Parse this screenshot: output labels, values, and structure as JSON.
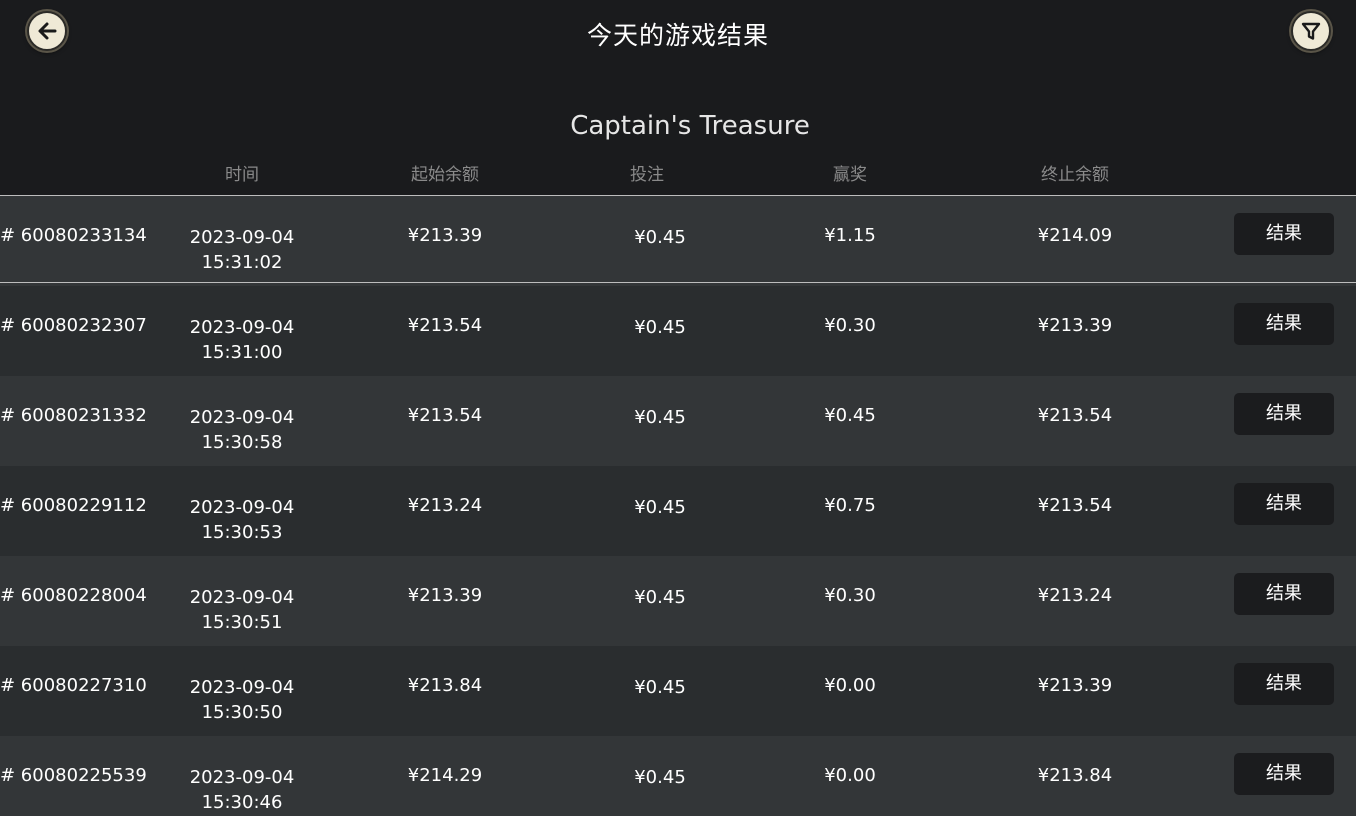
{
  "header": {
    "title": "今天的游戏结果",
    "back_icon": "arrow-left-icon",
    "filter_icon": "filter-funnel-icon"
  },
  "game": {
    "name": "Captain's Treasure"
  },
  "columns": {
    "time": "时间",
    "start_balance": "起始余额",
    "bet": "投注",
    "win": "赢奖",
    "end_balance": "终止余额"
  },
  "rows": [
    {
      "id": "# 60080233134",
      "date": "2023-09-04",
      "time": "15:31:02",
      "start": "¥213.39",
      "bet": "¥0.45",
      "win": "¥1.15",
      "end": "¥214.09",
      "result": "结果"
    },
    {
      "id": "# 60080232307",
      "date": "2023-09-04",
      "time": "15:31:00",
      "start": "¥213.54",
      "bet": "¥0.45",
      "win": "¥0.30",
      "end": "¥213.39",
      "result": "结果"
    },
    {
      "id": "# 60080231332",
      "date": "2023-09-04",
      "time": "15:30:58",
      "start": "¥213.54",
      "bet": "¥0.45",
      "win": "¥0.45",
      "end": "¥213.54",
      "result": "结果"
    },
    {
      "id": "# 60080229112",
      "date": "2023-09-04",
      "time": "15:30:53",
      "start": "¥213.24",
      "bet": "¥0.45",
      "win": "¥0.75",
      "end": "¥213.54",
      "result": "结果"
    },
    {
      "id": "# 60080228004",
      "date": "2023-09-04",
      "time": "15:30:51",
      "start": "¥213.39",
      "bet": "¥0.45",
      "win": "¥0.30",
      "end": "¥213.24",
      "result": "结果"
    },
    {
      "id": "# 60080227310",
      "date": "2023-09-04",
      "time": "15:30:50",
      "start": "¥213.84",
      "bet": "¥0.45",
      "win": "¥0.00",
      "end": "¥213.39",
      "result": "结果"
    },
    {
      "id": "# 60080225539",
      "date": "2023-09-04",
      "time": "15:30:46",
      "start": "¥214.29",
      "bet": "¥0.45",
      "win": "¥0.00",
      "end": "¥213.84",
      "result": "结果"
    }
  ]
}
